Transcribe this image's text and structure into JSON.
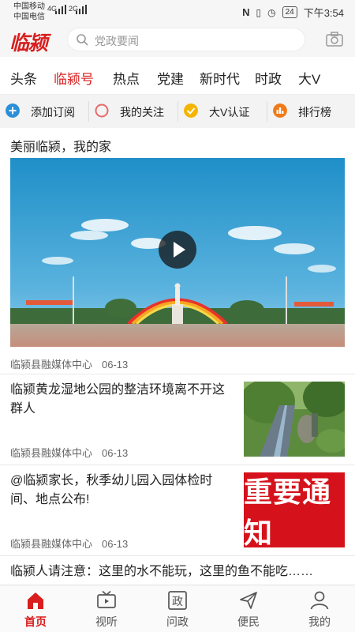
{
  "status_bar": {
    "carrier1": "中国移动",
    "carrier2": "中国电信",
    "net1": "4G",
    "net2": "2G",
    "battery": "24",
    "time": "下午3:54"
  },
  "header": {
    "logo": "临颍",
    "search_placeholder": "党政要闻"
  },
  "tabs": [
    "头条",
    "临颍号",
    "热点",
    "党建",
    "新时代",
    "时政",
    "大V"
  ],
  "active_tab": "临颍号",
  "actions": [
    {
      "label": "添加订阅",
      "icon": "plus-circle-icon",
      "color": "#2a8fd8"
    },
    {
      "label": "我的关注",
      "icon": "ring-icon",
      "color": "#e86a6a"
    },
    {
      "label": "大V认证",
      "icon": "check-badge-icon",
      "color": "#f5b400"
    },
    {
      "label": "排行榜",
      "icon": "rank-icon",
      "color": "#f07a1a"
    }
  ],
  "feed": {
    "section_title": "美丽临颍，我的家",
    "video_source": "临颍县融媒体中心",
    "video_date": "06-13",
    "articles": [
      {
        "title": "临颍黄龙湿地公园的整洁环境离不开这群人",
        "source": "临颍县融媒体中心",
        "date": "06-13"
      },
      {
        "title": "@临颍家长，秋季幼儿园入园体检时间、地点公布!",
        "source": "临颍县融媒体中心",
        "date": "06-13",
        "thumb_text": "重要通知"
      },
      {
        "title": "临颍人请注意：这里的水不能玩，这里的鱼不能吃……"
      }
    ]
  },
  "bottom_nav": [
    {
      "label": "首页",
      "icon": "home-icon"
    },
    {
      "label": "视听",
      "icon": "tv-icon"
    },
    {
      "label": "问政",
      "icon": "zheng-icon"
    },
    {
      "label": "便民",
      "icon": "send-icon"
    },
    {
      "label": "我的",
      "icon": "user-icon"
    }
  ],
  "accent_color": "#d81e1e"
}
